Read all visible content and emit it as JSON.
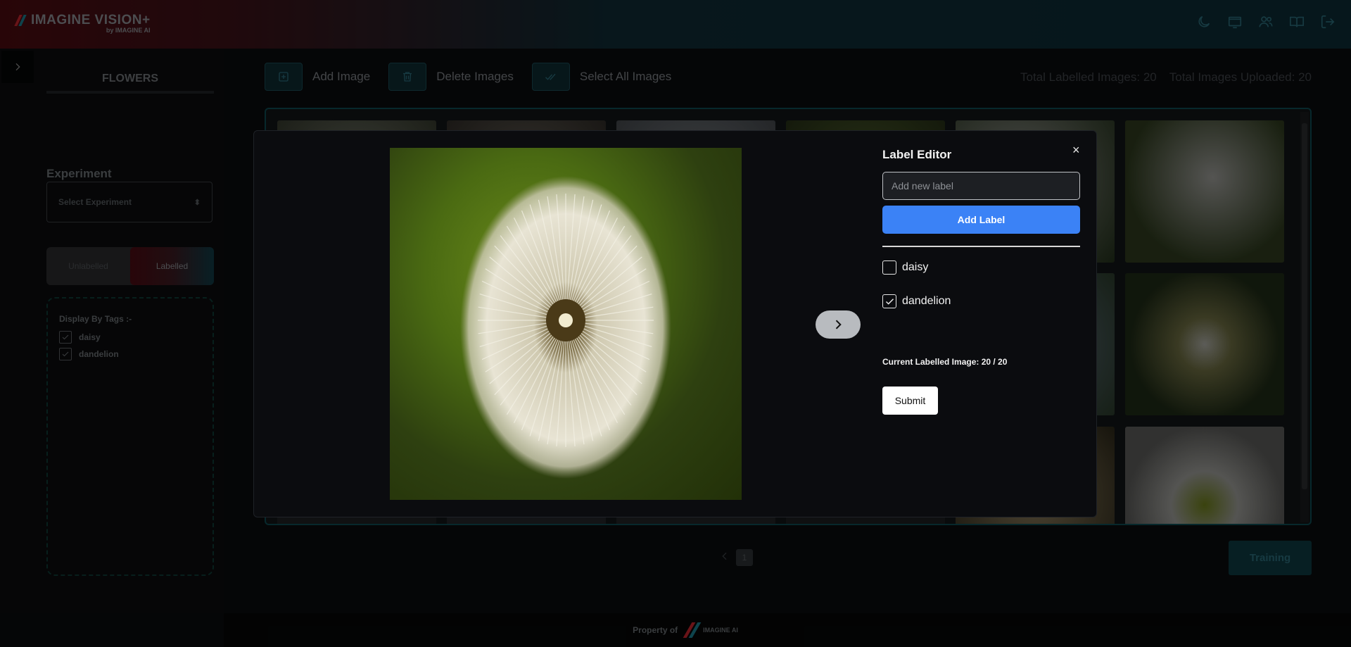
{
  "header": {
    "logo_name": "IMAGINE VISION+",
    "logo_sub": "by IMAGINE AI",
    "icons": [
      "moon-icon",
      "monitor-icon",
      "users-icon",
      "book-icon",
      "logout-icon"
    ]
  },
  "sidebar": {
    "project_title": "FLOWERS",
    "experiment_label": "Experiment",
    "experiment_placeholder": "Select Experiment",
    "toggle": {
      "unlabelled": "Unlabelled",
      "labelled": "Labelled",
      "active": "labelled"
    },
    "tags_title": "Display By Tags :-",
    "tags": [
      {
        "label": "daisy",
        "checked": true
      },
      {
        "label": "dandelion",
        "checked": true
      }
    ]
  },
  "toolbar": {
    "add_image": "Add Image",
    "delete_images": "Delete Images",
    "select_all": "Select All Images"
  },
  "stats": {
    "labelled": "Total Labelled Images: 20",
    "uploaded": "Total Images Uploaded: 20"
  },
  "pagination": {
    "current_page": "1"
  },
  "training_button": "Training",
  "footer": {
    "property_of": "Property of",
    "brand": "IMAGINE AI"
  },
  "modal": {
    "title": "Label Editor",
    "input_placeholder": "Add new label",
    "input_value": "",
    "add_label_button": "Add Label",
    "labels": [
      {
        "label": "daisy",
        "checked": false
      },
      {
        "label": "dandelion",
        "checked": true
      }
    ],
    "progress": "Current Labelled Image: 20 / 20",
    "submit_button": "Submit",
    "close_symbol": "×"
  },
  "colors": {
    "accent_blue": "#3b82f6",
    "teal": "#0e4a50",
    "brand_red": "#4a0a10"
  }
}
